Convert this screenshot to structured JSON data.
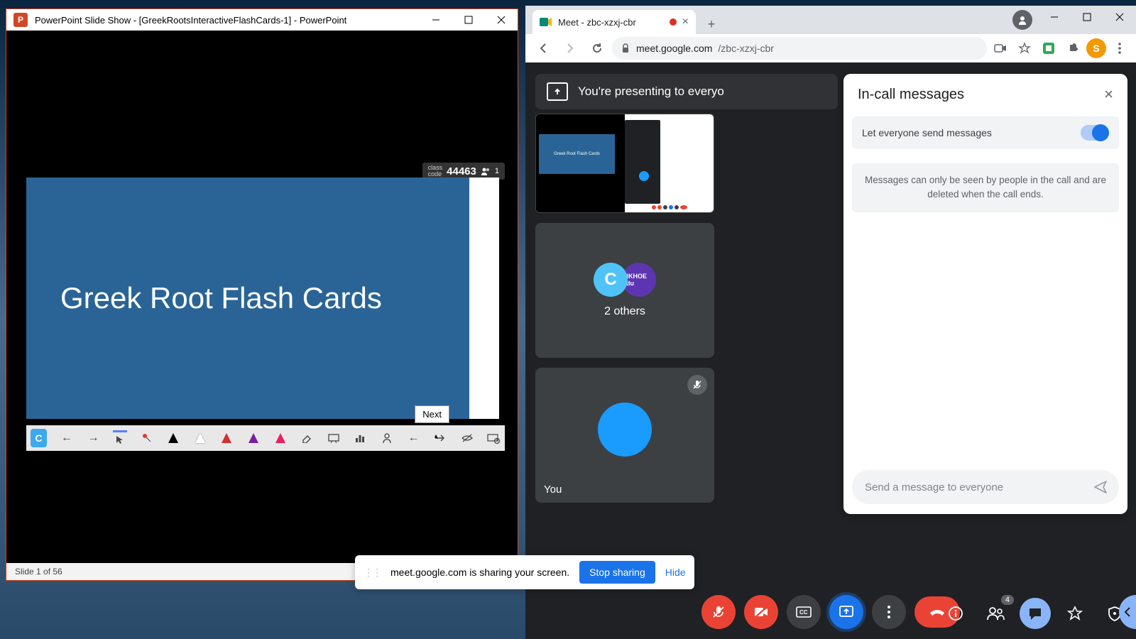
{
  "powerpoint": {
    "icon_letter": "P",
    "title": "PowerPoint Slide Show - [GreekRootsInteractiveFlashCards-1] - PowerPoint",
    "class_code_label": "class\ncode",
    "class_code_value": "44463",
    "class_attendee_count": "1",
    "slide_title": "Greek Root Flash Cards",
    "next_tooltip": "Next",
    "toolbar_app_letter": "C",
    "status_text": "Slide 1 of 56"
  },
  "chrome": {
    "tab_title": "Meet - zbc-xzxj-cbr",
    "url_host": "meet.google.com",
    "url_path": "/zbc-xzxj-cbr",
    "avatar_letter": "S"
  },
  "meet": {
    "presenting_banner": "You're presenting to everyo",
    "thumb_slide_text": "Greek Root Flash Cards",
    "others_label": "2 others",
    "others_avatar1": "C",
    "others_avatar2": "INKHOE Edu",
    "you_label": "You",
    "people_badge": "4"
  },
  "chat": {
    "title": "In-call messages",
    "toggle_label": "Let everyone send messages",
    "info_text": "Messages can only be seen by people in the call and are deleted when the call ends.",
    "input_placeholder": "Send a message to everyone"
  },
  "share": {
    "text": "meet.google.com is sharing your screen.",
    "stop": "Stop sharing",
    "hide": "Hide"
  }
}
